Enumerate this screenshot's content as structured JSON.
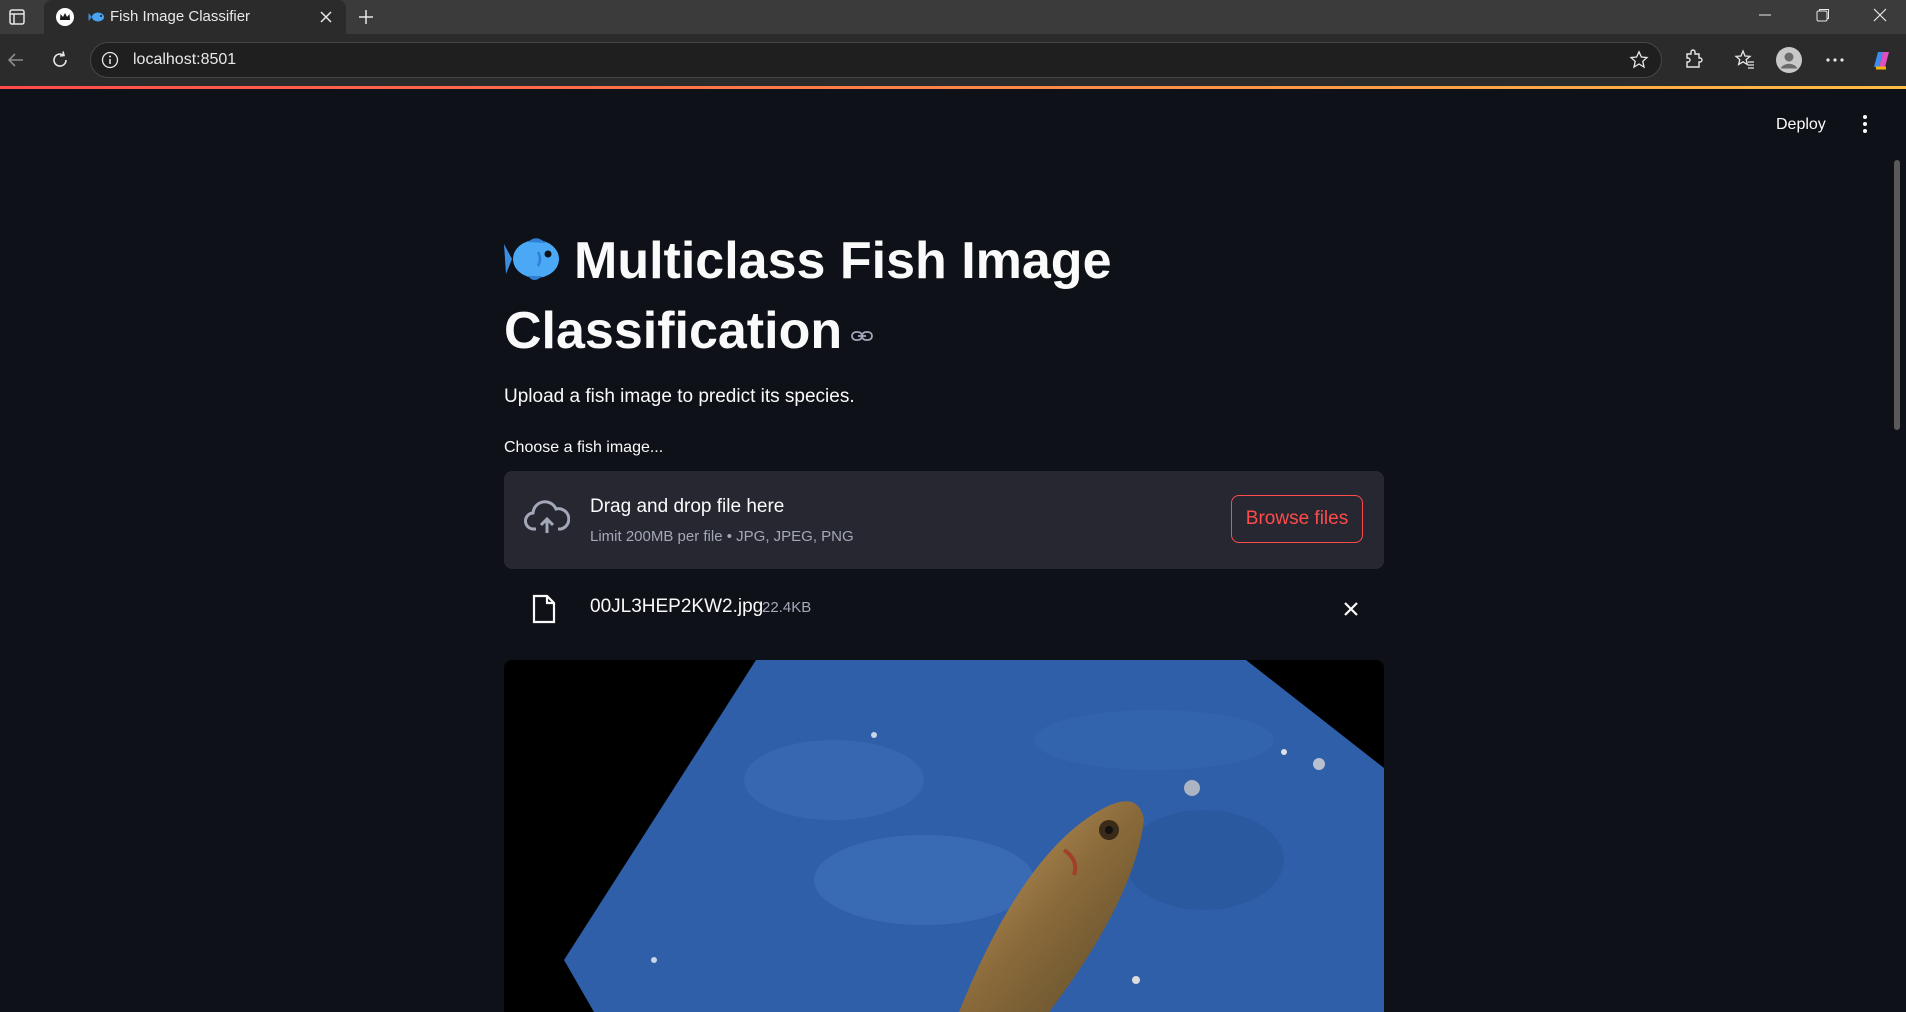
{
  "browser": {
    "tab_title": "Fish Image Classifier",
    "url": "localhost:8501"
  },
  "app": {
    "deploy_label": "Deploy",
    "title": "Multiclass Fish Image Classification",
    "subtitle": "Upload a fish image to predict its species.",
    "uploader": {
      "label": "Choose a fish image...",
      "drop_title": "Drag and drop file here",
      "limit_text": "Limit 200MB per file • JPG, JPEG, PNG",
      "browse_label": "Browse files"
    },
    "uploaded_file": {
      "name": "00JL3HEP2KW2.jpg",
      "size": "22.4KB"
    }
  },
  "colors": {
    "background": "#0e1117",
    "accent": "#ff4b4b",
    "dropzone": "#262730"
  }
}
